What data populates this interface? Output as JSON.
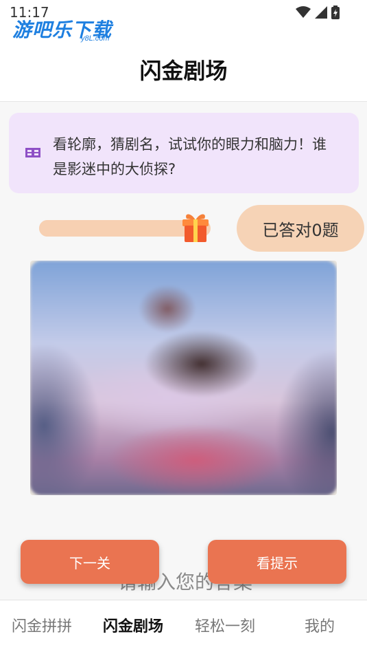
{
  "status_bar": {
    "time": "11:17"
  },
  "brand": {
    "logo_text": "游吧乐下载",
    "logo_sub": "y8L.com"
  },
  "header": {
    "title": "闪金剧场"
  },
  "tip": {
    "icon": "film-icon",
    "text": "看轮廓，猜剧名，试试你的眼力和脑力！谁是影迷中的大侦探?"
  },
  "progress": {
    "fraction": 0.9,
    "icon": "gift-icon",
    "answered_label": "已答对0题"
  },
  "answer": {
    "placeholder": "请输入您的答案"
  },
  "buttons": {
    "next_label": "下一关",
    "hint_label": "看提示"
  },
  "tabs": [
    {
      "label": "闪金拼拼",
      "active": false
    },
    {
      "label": "闪金剧场",
      "active": true
    },
    {
      "label": "轻松一刻",
      "active": false
    },
    {
      "label": "我的",
      "active": false
    }
  ],
  "colors": {
    "accent": "#ea7451",
    "tip_bg": "#f1e4fb",
    "badge_bg": "#f6d3b6",
    "logo_blue": "#1e7fe0"
  }
}
